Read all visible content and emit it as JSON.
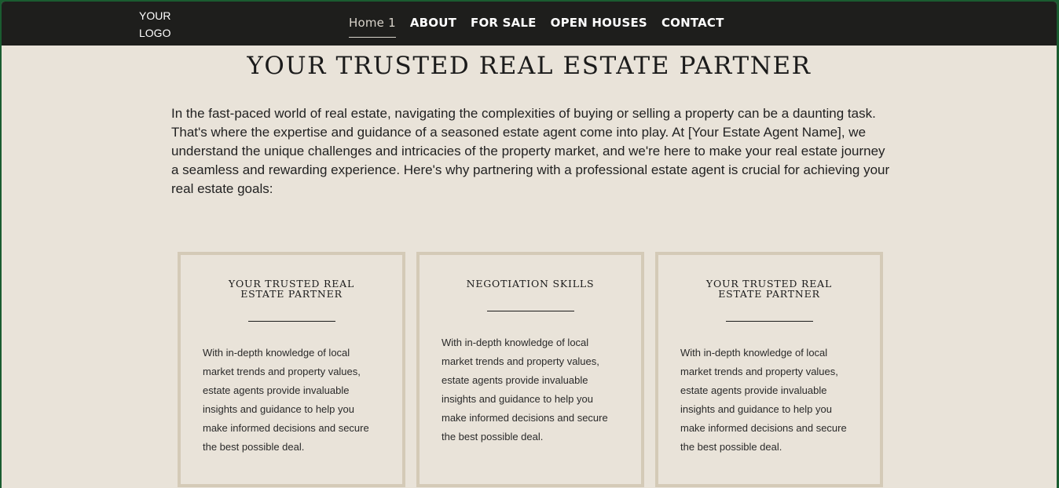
{
  "header": {
    "logo_line1": "YOUR",
    "logo_line2": "LOGO",
    "nav": [
      {
        "label": "Home 1"
      },
      {
        "label": "ABOUT"
      },
      {
        "label": "FOR SALE"
      },
      {
        "label": "OPEN HOUSES"
      },
      {
        "label": "CONTACT"
      }
    ]
  },
  "main": {
    "title": "YOUR TRUSTED REAL ESTATE PARTNER",
    "intro": "In the fast-paced world of real estate, navigating the complexities of buying or selling a property can be a daunting task. That's where the expertise and guidance of a seasoned estate agent come into play. At [Your Estate Agent Name], we understand the unique challenges and intricacies of the property market, and we're here to make your real estate journey a seamless and rewarding experience. Here's why partnering with a professional estate agent is crucial for achieving your real estate goals:",
    "cards": [
      {
        "title": "YOUR TRUSTED REAL ESTATE PARTNER",
        "text": "With in-depth knowledge of local market trends and property values, estate agents provide invaluable insights and guidance to help you make informed decisions and secure the best possible deal."
      },
      {
        "title": "NEGOTIATION SKILLS",
        "text": "With in-depth knowledge of local market trends and property values, estate agents provide invaluable insights and guidance to help you make informed decisions and secure the best possible deal."
      },
      {
        "title": "YOUR TRUSTED REAL ESTATE PARTNER",
        "text": "With in-depth knowledge of local market trends and property values, estate agents provide invaluable insights and guidance to help you make informed decisions and secure the best possible deal."
      }
    ]
  },
  "colors": {
    "nav_bg": "#1e1e1c",
    "page_bg": "#e9e3d9",
    "card_border": "#d4cab7",
    "window_accent": "#1a5c30"
  }
}
